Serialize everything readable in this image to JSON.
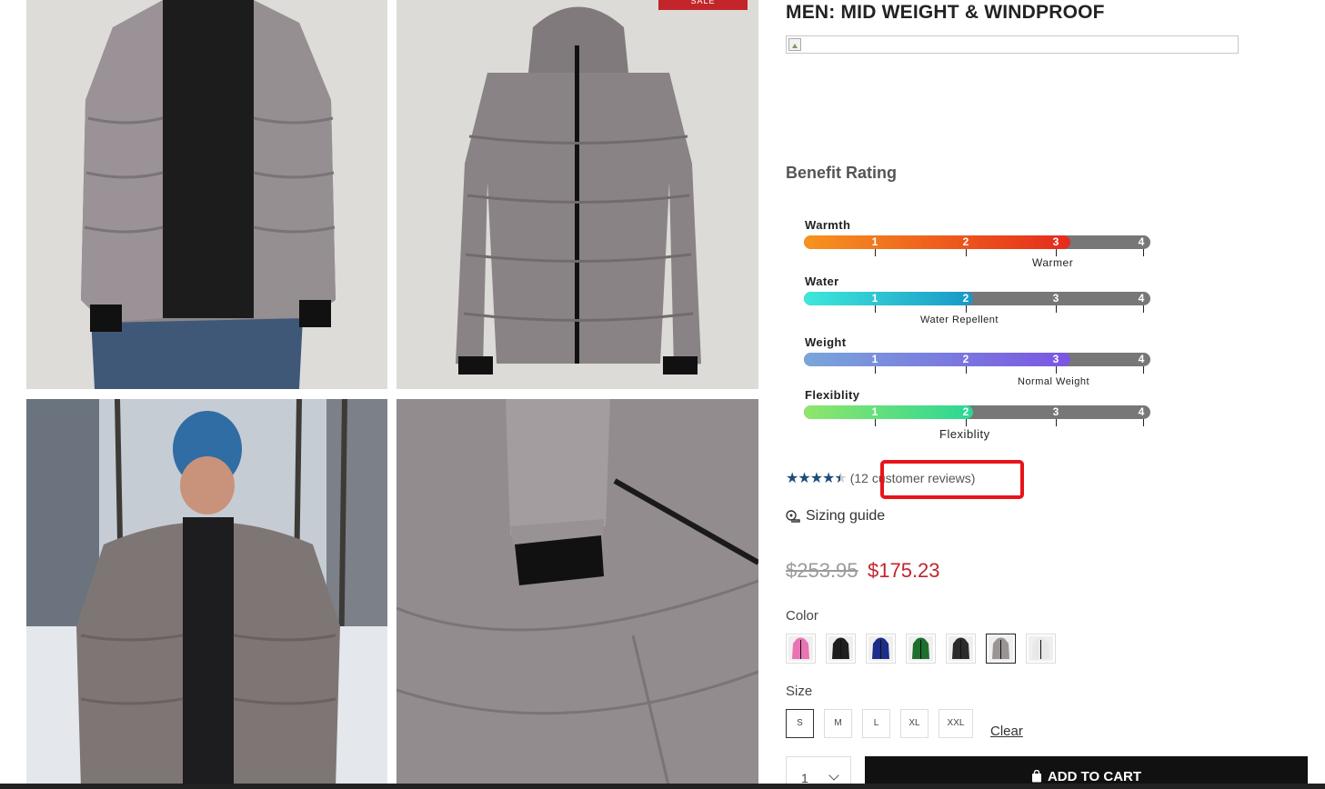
{
  "product": {
    "title": "MEN: MID WEIGHT & WINDPROOF",
    "sale_badge": "SALE"
  },
  "benefit_rating": {
    "heading": "Benefit Rating",
    "scale": [
      "1",
      "2",
      "3",
      "4"
    ],
    "items": [
      {
        "label": "Warmth",
        "level": 3,
        "caption": "Warmer"
      },
      {
        "label": "Water",
        "level": 2,
        "caption": "Water Repellent"
      },
      {
        "label": "Weight",
        "level": 3,
        "caption": "Normal Weight"
      },
      {
        "label": "Flexiblity",
        "level": 2,
        "caption": "Flexiblity"
      }
    ],
    "colors": {
      "warmth": [
        "#f7931e",
        "#e52b1c"
      ],
      "water": [
        "#3ee8da",
        "#1a97c8"
      ],
      "weight": [
        "#7aa6da",
        "#7b55e3"
      ],
      "flex": [
        "#8fe66a",
        "#2cd795"
      ]
    }
  },
  "reviews": {
    "rating": 4.5,
    "stars": "★★★★",
    "half_star": "★",
    "text": "(12 customer reviews)"
  },
  "sizing": {
    "icon": "measuring-tape-icon",
    "label": "Sizing guide"
  },
  "price": {
    "original": "$253.95",
    "sale": "$175.23",
    "original_color": "#9b9b9b",
    "sale_color": "#c0262c"
  },
  "color_option": {
    "label": "Color",
    "swatches": [
      {
        "color": "#e874b4"
      },
      {
        "color": "#1e1e1e"
      },
      {
        "color": "#1d2d8a"
      },
      {
        "color": "#1e6e2c"
      },
      {
        "color": "#2c2c2c"
      },
      {
        "color": "#9a9494",
        "selected": true
      },
      {
        "color": "#e8e8ea"
      }
    ]
  },
  "size_option": {
    "label": "Size",
    "sizes": [
      "S",
      "M",
      "L",
      "XL",
      "XXL"
    ],
    "selected": "S",
    "clear_label": "Clear"
  },
  "cart": {
    "quantity": "1",
    "add_label": "ADD TO CART",
    "icon": "shopping-bag-icon"
  },
  "accent": {
    "highlight_box": "#e8141a",
    "star_color": "#1f4d7a"
  }
}
